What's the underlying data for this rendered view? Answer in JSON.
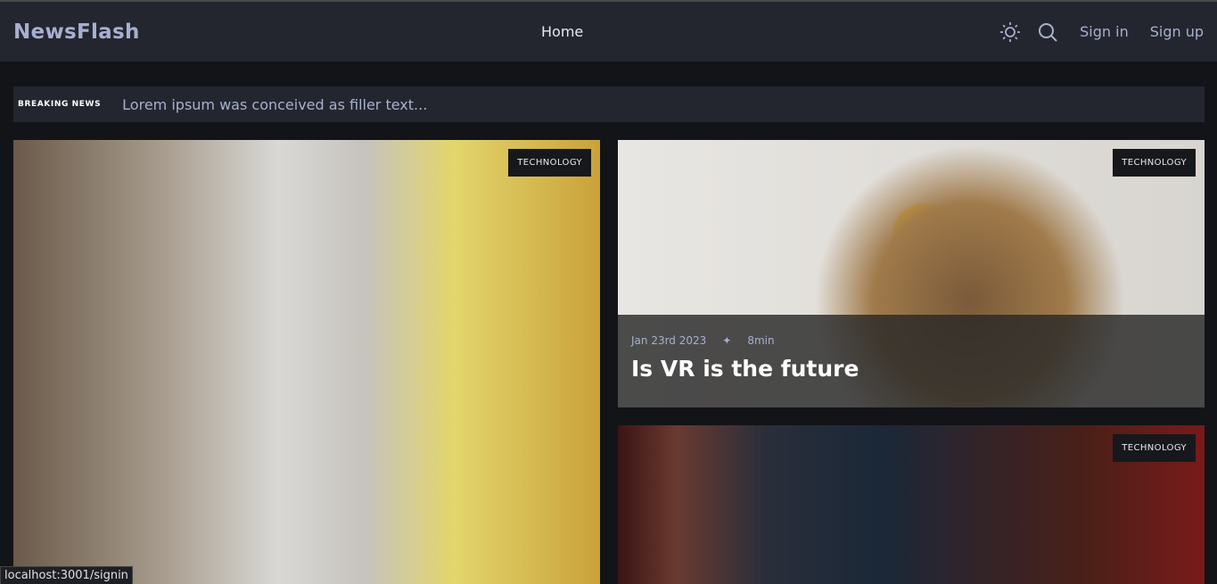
{
  "header": {
    "logo": "NewsFlash",
    "nav_home": "Home",
    "sign_in": "Sign in",
    "sign_up": "Sign up",
    "icons": [
      "sun-icon",
      "search-icon"
    ]
  },
  "ticker": {
    "label": "BREAKING NEWS",
    "text": "Lorem ipsum was conceived as filler text..."
  },
  "cards": [
    {
      "tag": "TECHNOLOGY"
    },
    {
      "tag": "TECHNOLOGY",
      "date": "Jan 23rd 2023",
      "separator": "✦",
      "duration": "8min",
      "title": "Is VR is the future"
    },
    {
      "tag": "TECHNOLOGY"
    }
  ],
  "status_bar": "localhost:3001/signin"
}
